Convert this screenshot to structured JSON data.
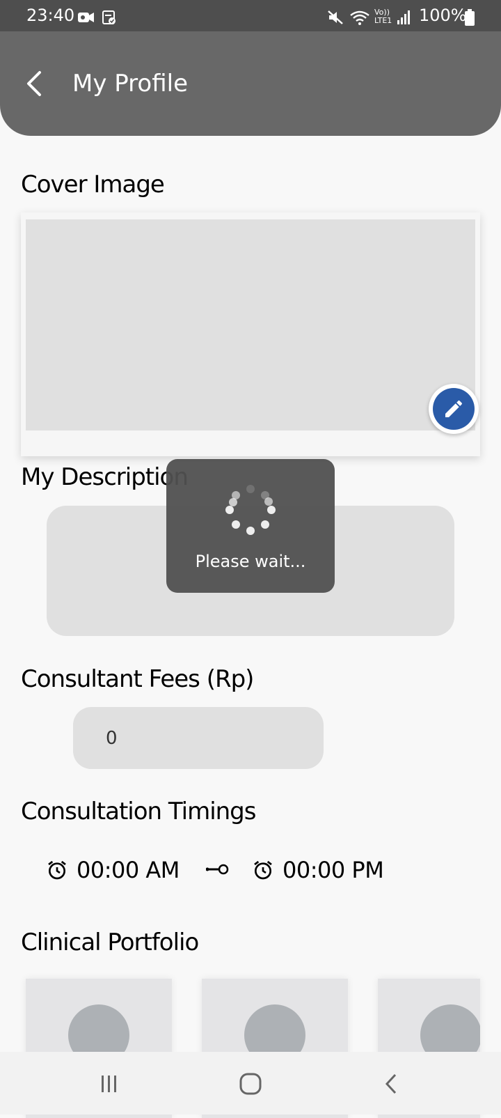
{
  "status_bar": {
    "time": "23:40",
    "battery": "100%",
    "icons": [
      "video-camera-icon",
      "screenshot-icon",
      "mute-icon",
      "wifi-icon",
      "volte-icon",
      "signal-icon",
      "battery-icon"
    ]
  },
  "header": {
    "title": "My Profile",
    "back_icon": "chevron-left-icon",
    "color": "#686868"
  },
  "cover": {
    "section_title": "Cover Image",
    "edit_icon": "pencil-icon",
    "edit_color": "#2a5ba8"
  },
  "description": {
    "section_title": "My Description",
    "value": ""
  },
  "fees": {
    "section_title": "Consultant Fees (Rp)",
    "value": "0"
  },
  "timings": {
    "section_title": "Consultation Timings",
    "start": "00:00 AM",
    "end": "00:00 PM",
    "icons": [
      "alarm-clock-icon",
      "range-connector-icon"
    ]
  },
  "portfolio": {
    "section_title": "Clinical Portfolio",
    "items": [
      {
        "icon": "image-placeholder-icon"
      },
      {
        "icon": "image-placeholder-icon"
      },
      {
        "icon": "image-placeholder-icon"
      }
    ]
  },
  "loading": {
    "text": "Please wait..."
  },
  "nav_bar": {
    "icons": [
      "recent-apps-icon",
      "home-icon",
      "back-icon"
    ]
  }
}
